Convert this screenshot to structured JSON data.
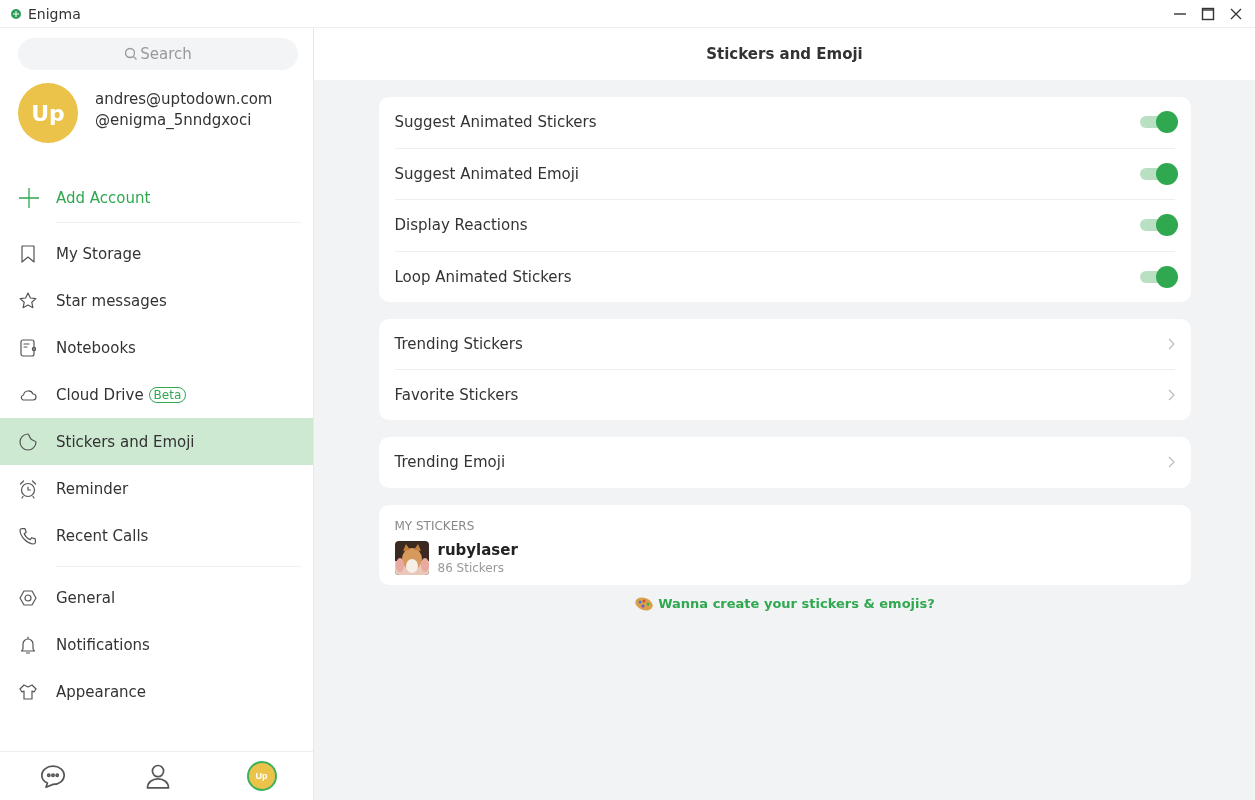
{
  "window": {
    "title": "Enigma"
  },
  "sidebar": {
    "search": {
      "placeholder": "Search"
    },
    "account": {
      "avatar": "Up",
      "email": "andres@uptodown.com",
      "handle": "@enigma_5nndgxoci"
    },
    "add_account": "Add Account",
    "groups": [
      [
        {
          "label": "My Storage",
          "selected": false
        },
        {
          "label": "Star messages",
          "selected": false
        },
        {
          "label": "Notebooks",
          "selected": false
        },
        {
          "label": "Cloud Drive",
          "badge": "Beta",
          "selected": false
        },
        {
          "label": "Stickers and Emoji",
          "selected": true
        },
        {
          "label": "Reminder",
          "selected": false
        },
        {
          "label": "Recent Calls",
          "selected": false
        }
      ],
      [
        {
          "label": "General",
          "selected": false
        },
        {
          "label": "Notifications",
          "selected": false
        },
        {
          "label": "Appearance",
          "selected": false
        }
      ]
    ],
    "bottom_tabs": [
      {
        "selected": false
      },
      {
        "selected": false
      },
      {
        "label": "Up",
        "selected": true
      }
    ]
  },
  "main": {
    "title": "Stickers and Emoji",
    "sections": [
      [
        {
          "kind": "toggle",
          "label": "Suggest Animated Stickers",
          "on": true
        },
        {
          "kind": "toggle",
          "label": "Suggest Animated Emoji",
          "on": true
        },
        {
          "kind": "toggle",
          "label": "Display Reactions",
          "on": true
        },
        {
          "kind": "toggle",
          "label": "Loop Animated Stickers",
          "on": true
        }
      ],
      [
        {
          "kind": "link",
          "label": "Trending Stickers"
        },
        {
          "kind": "link",
          "label": "Favorite Stickers"
        }
      ],
      [
        {
          "kind": "link",
          "label": "Trending Emoji"
        }
      ]
    ],
    "my_stickers": {
      "heading": "MY STICKERS",
      "packs": [
        {
          "name": "rubylaser",
          "count": "86 Stickers"
        }
      ]
    },
    "create_link": "Wanna create your stickers & emojis?"
  }
}
